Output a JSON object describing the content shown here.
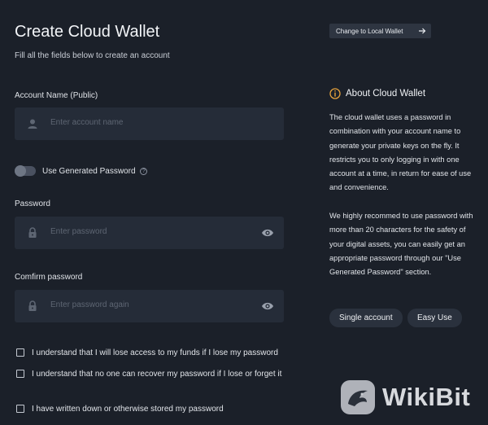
{
  "header": {
    "title": "Create Cloud Wallet",
    "subtitle": "Fill all the fields below to create an account"
  },
  "form": {
    "account_name": {
      "label": "Account Name (Public)",
      "placeholder": "Enter account name"
    },
    "generated_toggle": {
      "label": "Use Generated Password",
      "on": false,
      "help_icon": "question-circle-icon"
    },
    "password": {
      "label": "Password",
      "placeholder": "Enter password"
    },
    "confirm": {
      "label": "Comfirm password",
      "placeholder": "Enter password again"
    },
    "checkboxes": [
      "I understand that I will lose access to my funds if I lose my password",
      "I understand that no one can recover my password if I lose or forget it",
      "I have written down or otherwise stored my password"
    ]
  },
  "sidebar": {
    "switch_button": "Change to Local Wallet",
    "about_title": "About Cloud Wallet",
    "paragraph_1": "The cloud wallet uses a password in combination with your account name to generate your private keys on the fly. It restricts you to only logging in with one account at a time, in return for ease of use and convenience.",
    "paragraph_2": "We highly recommed to use password with more than 20 characters for the safety of your digital assets, you can easily get an appropriate password through our \"Use Generated Password\" section.",
    "tags": [
      "Single account",
      "Easy Use"
    ]
  },
  "watermark": {
    "text": "WikiBit"
  },
  "colors": {
    "background": "#1b2029",
    "input": "#252c38",
    "info_accent": "#e8a33c"
  }
}
